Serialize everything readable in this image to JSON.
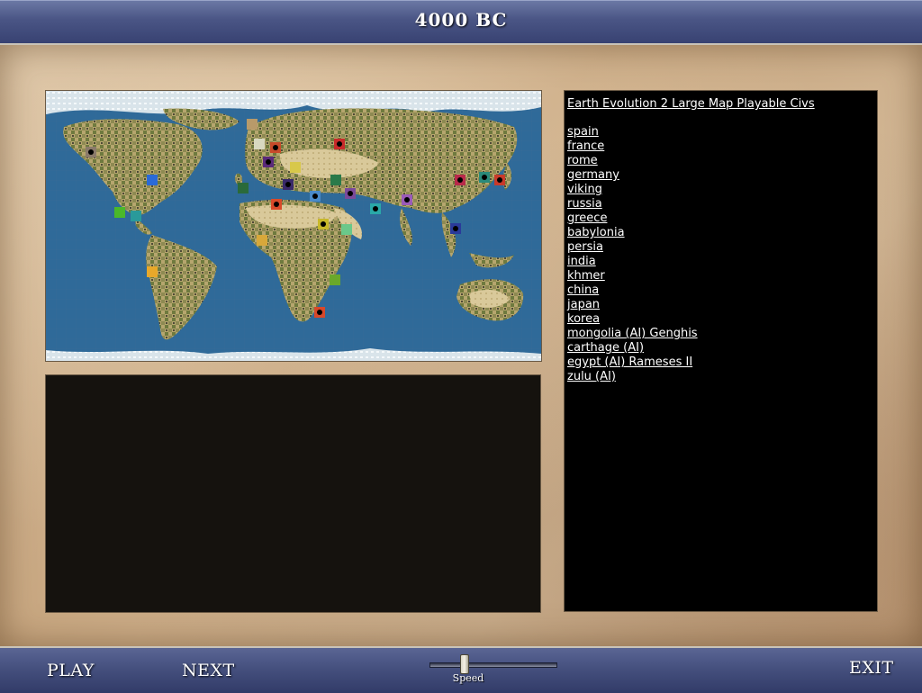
{
  "header": {
    "title": "4000 BC"
  },
  "civ_panel": {
    "title": "Earth Evolution 2 Large Map Playable Civs",
    "civs": [
      "spain",
      "france",
      "rome",
      "germany",
      "viking",
      "russia",
      "greece",
      "babylonia",
      "persia",
      "india",
      "khmer",
      "china",
      "japan",
      "korea",
      "mongolia (AI) Genghis",
      "carthage (AI) ",
      "egypt (AI) Rameses II",
      "zulu (AI)"
    ]
  },
  "bottom": {
    "play_label": "PLAY",
    "next_label": "NEXT",
    "speed_label": "Speed",
    "exit_label": "EXIT"
  },
  "map_markers": [
    {
      "color": "#8a7a6a"
    },
    {
      "color": "#b89a6a"
    },
    {
      "color": "#d8d8c0"
    },
    {
      "color": "#c84a2a"
    },
    {
      "color": "#5a2a7a"
    },
    {
      "color": "#d8c84a"
    },
    {
      "color": "#2a6a3a"
    },
    {
      "color": "#d8a83a"
    },
    {
      "color": "#3a2a6a"
    },
    {
      "color": "#2a7a4a"
    },
    {
      "color": "#4a8ac8"
    },
    {
      "color": "#7a4a9a"
    },
    {
      "color": "#2aa8a8"
    },
    {
      "color": "#9a5ab8"
    },
    {
      "color": "#c82a2a"
    },
    {
      "color": "#d84a2a"
    },
    {
      "color": "#c8b82a"
    },
    {
      "color": "#6ac88a"
    },
    {
      "color": "#4ab82a"
    },
    {
      "color": "#2a9a9a"
    },
    {
      "color": "#2a6ad8"
    },
    {
      "color": "#e8a82a"
    },
    {
      "color": "#6aa82a"
    },
    {
      "color": "#d8482a"
    },
    {
      "color": "#2a3a9a"
    },
    {
      "color": "#b82a4a"
    },
    {
      "color": "#2a8a7a"
    },
    {
      "color": "#c83a2a"
    }
  ]
}
